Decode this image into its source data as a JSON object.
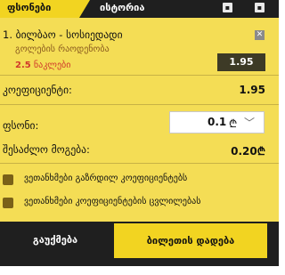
{
  "tabs": {
    "active_label": "ფსონები",
    "second_label": "ისტორია",
    "icon_one": "▪",
    "icon_two": "▪"
  },
  "selection": {
    "title": "1. ბილბაო - სოსიედადი",
    "market": "გოლების რაოდენობა",
    "line_value": "2.5",
    "line_unit": "ნაკლები",
    "odds": "1.95",
    "close_glyph": "✕"
  },
  "summary": {
    "coefficient_label": "კოეფიციენტი:",
    "coefficient_value": "1.95",
    "stake_label": "ფსონი:",
    "stake_value": "0.1",
    "currency": "₾",
    "chevron": "﹀",
    "win_label": "შესაძლო მოგება:",
    "win_value": "0.20₾"
  },
  "options": {
    "accept_higher": "ვეთანხმები გაზრდილ კოეფიციენტებს",
    "accept_changes": "ვეთანხმები კოეფიციენტების ცვლილებას"
  },
  "actions": {
    "cancel_label": "გაუქმება",
    "place_label": "ბილეთის დადება"
  },
  "colors": {
    "accent": "#f2d421",
    "panel": "#f4dd55",
    "dark": "#1f1f1f",
    "odds_box": "#3d3a26",
    "highlight_red": "#d0382a"
  }
}
